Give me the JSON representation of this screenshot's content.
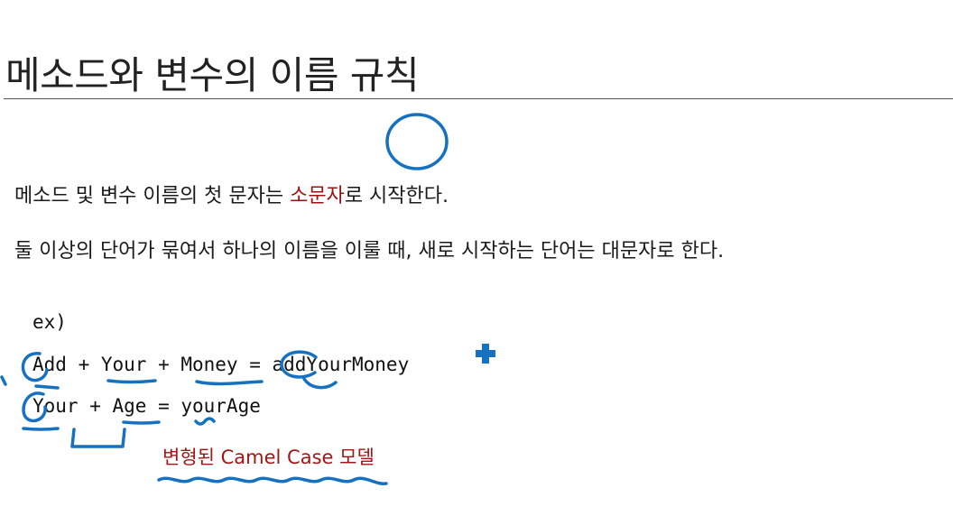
{
  "slide": {
    "title": "메소드와 변수의 이름 규칙"
  },
  "rules": {
    "rule1_before": "메소드 및 변수 이름의 첫 문자는 ",
    "rule1_highlight": "소문자",
    "rule1_after": "로 시작한다.",
    "rule2": "둘 이상의 단어가 묶여서 하나의 이름을 이룰 때, 새로 시작하는 단어는 대문자로 한다."
  },
  "example": {
    "label": "ex)",
    "line1": "Add + Your + Money = addYourMoney",
    "line2": "Your + Age = yourAge"
  },
  "caption": {
    "text": "변형된 Camel Case 모델"
  },
  "colors": {
    "highlight": "#9b1212",
    "caption": "#a31616",
    "ink": "#1672c1"
  },
  "icons": {
    "cursor": "plus-cursor-icon"
  }
}
